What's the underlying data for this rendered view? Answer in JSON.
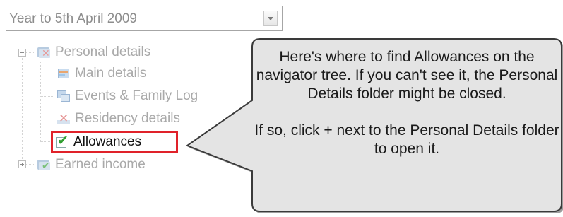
{
  "period_select": {
    "value": "Year to 5th April 2009"
  },
  "tree": {
    "personal_details": "Personal details",
    "main_details": "Main details",
    "events_family_log": "Events & Family Log",
    "residency_details": "Residency details",
    "allowances": "Allowances",
    "earned_income": "Earned income"
  },
  "callout": {
    "para1": "Here's where to find Allowances on the navigator tree. If you can't see it, the Personal Details folder might be closed.",
    "para2": "If so, click + next to the Personal Details folder to open it."
  },
  "colors": {
    "highlight": "#e0222a",
    "callout_bg": "#e4e4e4"
  }
}
